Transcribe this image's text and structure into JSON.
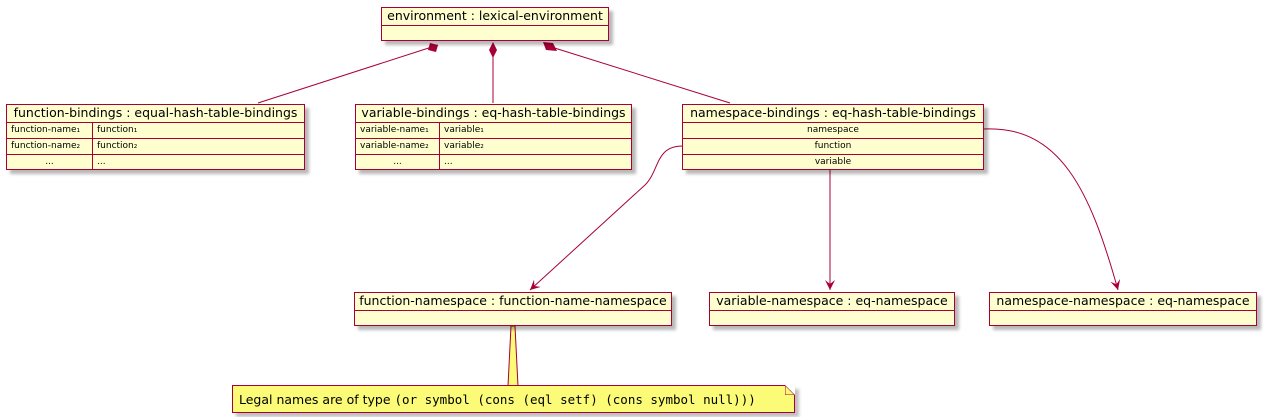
{
  "objects": {
    "environment": {
      "title": "environment : lexical-environment"
    },
    "function_bindings": {
      "title": "function-bindings : equal-hash-table-bindings",
      "rows": [
        {
          "key": "function-name₁",
          "value": "function₁"
        },
        {
          "key": "function-name₂",
          "value": "function₂"
        },
        {
          "key": "...",
          "value": "..."
        }
      ]
    },
    "variable_bindings": {
      "title": "variable-bindings : eq-hash-table-bindings",
      "rows": [
        {
          "key": "variable-name₁",
          "value": "variable₁"
        },
        {
          "key": "variable-name₂",
          "value": "variable₂"
        },
        {
          "key": "...",
          "value": "..."
        }
      ]
    },
    "namespace_bindings": {
      "title": "namespace-bindings : eq-hash-table-bindings",
      "rows": [
        "namespace",
        "function",
        "variable"
      ]
    },
    "function_namespace": {
      "title": "function-namespace : function-name-namespace"
    },
    "variable_namespace": {
      "title": "variable-namespace : eq-namespace"
    },
    "namespace_namespace": {
      "title": "namespace-namespace : eq-namespace"
    }
  },
  "note": {
    "prefix": "Legal names are of type ",
    "code": "(or symbol (cons (eql setf) (cons symbol null)))"
  },
  "colors": {
    "border": "#A80036",
    "object_fill": "#FEFECE",
    "note_fill": "#FBFB77"
  },
  "relations": [
    {
      "from": "environment",
      "to": "function_bindings",
      "type": "composition"
    },
    {
      "from": "environment",
      "to": "variable_bindings",
      "type": "composition"
    },
    {
      "from": "environment",
      "to": "namespace_bindings",
      "type": "composition"
    },
    {
      "from": "namespace_bindings.function",
      "to": "function_namespace",
      "type": "arrow"
    },
    {
      "from": "namespace_bindings.variable",
      "to": "variable_namespace",
      "type": "arrow"
    },
    {
      "from": "namespace_bindings.namespace",
      "to": "namespace_namespace",
      "type": "arrow"
    }
  ]
}
